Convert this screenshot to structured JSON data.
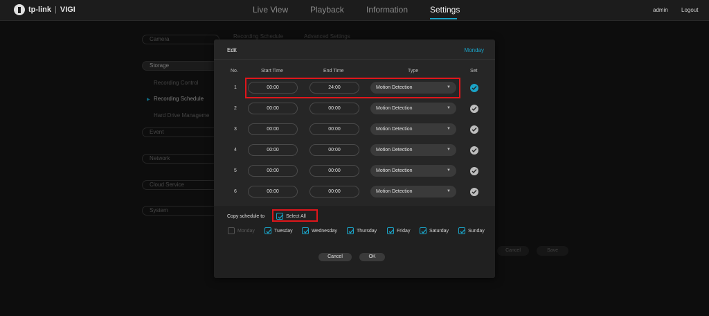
{
  "brand": {
    "name": "tp-link",
    "product": "VIGI"
  },
  "nav": {
    "items": [
      "Live View",
      "Playback",
      "Information",
      "Settings"
    ],
    "active": "Settings"
  },
  "user": {
    "name": "admin",
    "logout": "Logout"
  },
  "sidebar": {
    "camera": "Camera",
    "storage": "Storage",
    "storage_sub": [
      "Recording Control",
      "Recording Schedule",
      "Hard Drive Manageme"
    ],
    "event": "Event",
    "network": "Network",
    "cloud": "Cloud Service",
    "system": "System"
  },
  "bg_tabs": {
    "recording_schedule": "Recording Schedule",
    "advanced": "Advanced Settings"
  },
  "bg_buttons": {
    "cancel": "Cancel",
    "save": "Save"
  },
  "modal": {
    "title": "Edit",
    "day": "Monday",
    "headers": {
      "no": "No.",
      "start": "Start Time",
      "end": "End Time",
      "type": "Type",
      "set": "Set"
    },
    "rows": [
      {
        "no": "1",
        "start": "00:00",
        "end": "24:00",
        "type": "Motion Detection",
        "set": true
      },
      {
        "no": "2",
        "start": "00:00",
        "end": "00:00",
        "type": "Motion Detection",
        "set": false
      },
      {
        "no": "3",
        "start": "00:00",
        "end": "00:00",
        "type": "Motion Detection",
        "set": false
      },
      {
        "no": "4",
        "start": "00:00",
        "end": "00:00",
        "type": "Motion Detection",
        "set": false
      },
      {
        "no": "5",
        "start": "00:00",
        "end": "00:00",
        "type": "Motion Detection",
        "set": false
      },
      {
        "no": "6",
        "start": "00:00",
        "end": "00:00",
        "type": "Motion Detection",
        "set": false
      }
    ],
    "copy_label": "Copy schedule to",
    "select_all": "Select All",
    "days": [
      {
        "label": "Monday",
        "checked": false,
        "disabled": true
      },
      {
        "label": "Tuesday",
        "checked": true,
        "disabled": false
      },
      {
        "label": "Wednesday",
        "checked": true,
        "disabled": false
      },
      {
        "label": "Thursday",
        "checked": true,
        "disabled": false
      },
      {
        "label": "Friday",
        "checked": true,
        "disabled": false
      },
      {
        "label": "Saturday",
        "checked": true,
        "disabled": false
      },
      {
        "label": "Sunday",
        "checked": true,
        "disabled": false
      }
    ],
    "cancel": "Cancel",
    "ok": "OK"
  },
  "colors": {
    "accent": "#1aa3c7",
    "highlight": "#e0161b"
  }
}
